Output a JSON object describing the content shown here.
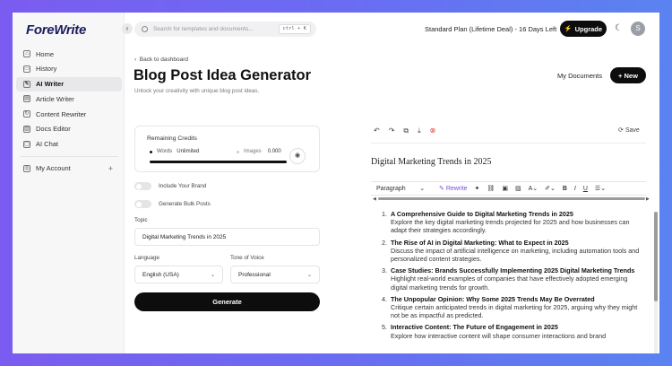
{
  "app": {
    "logo": "ForeWrite"
  },
  "sidebar": {
    "items": [
      {
        "label": "Home",
        "icon": "home-icon",
        "glyph": "⌂"
      },
      {
        "label": "History",
        "icon": "history-icon",
        "glyph": "▭"
      },
      {
        "label": "AI Writer",
        "icon": "ai-writer-icon",
        "glyph": "✎"
      },
      {
        "label": "Article Writer",
        "icon": "article-icon",
        "glyph": "▤"
      },
      {
        "label": "Content Rewriter",
        "icon": "rewriter-icon",
        "glyph": "↻"
      },
      {
        "label": "Docs Editor",
        "icon": "docs-icon",
        "glyph": "▥"
      },
      {
        "label": "AI Chat",
        "icon": "chat-icon",
        "glyph": "▢"
      }
    ],
    "account": {
      "label": "My Account",
      "plus": "+"
    }
  },
  "topbar": {
    "search_placeholder": "Search for templates and documents...",
    "shortcut": "ctrl + K",
    "plan": "Standard Plan (Lifetime Deal) - 16 Days Left",
    "upgrade": "Upgrade",
    "avatar": "S"
  },
  "header": {
    "back": "Back to dashboard",
    "title": "Blog Post Idea Generator",
    "subtitle": "Unlock your creativity with unique blog post ideas.",
    "my_documents": "My Documents",
    "new": "New"
  },
  "credits": {
    "title": "Remaining Credits",
    "words_label": "Words",
    "words_value": "Unlimited",
    "images_label": "Images",
    "images_value": "0.000",
    "bar_fill": 1.0
  },
  "form": {
    "toggle_brand": "Include Your Brand",
    "toggle_bulk": "Generate Bulk Posts",
    "topic_label": "Topic",
    "topic_value": "Digital Marketing Trends in 2025",
    "language_label": "Language",
    "language_value": "English (USA)",
    "tone_label": "Tone of Voice",
    "tone_value": "Professional",
    "generate": "Generate"
  },
  "editor": {
    "save": "Save",
    "title": "Digital Marketing Trends in 2025",
    "paragraph_style": "Paragraph",
    "rewrite": "Rewrite",
    "items": [
      {
        "num": "1.",
        "title": "A Comprehensive Guide to Digital Marketing Trends in 2025",
        "desc": "Explore the key digital marketing trends projected for 2025 and how businesses can adapt their strategies accordingly."
      },
      {
        "num": "2.",
        "title": "The Rise of AI in Digital Marketing: What to Expect in 2025",
        "desc": "Discuss the impact of artificial intelligence on marketing, including automation tools and personalized content strategies."
      },
      {
        "num": "3.",
        "title": "Case Studies: Brands Successfully Implementing 2025 Digital Marketing Trends",
        "desc": "Highlight real-world examples of companies that have effectively adopted emerging digital marketing trends for growth."
      },
      {
        "num": "4.",
        "title": "The Unpopular Opinion: Why Some 2025 Trends May Be Overrated",
        "desc": "Critique certain anticipated trends in digital marketing for 2025, arguing why they might not be as impactful as predicted."
      },
      {
        "num": "5.",
        "title": "Interactive Content: The Future of Engagement in 2025",
        "desc": "Explore how interactive content will shape consumer interactions and brand"
      }
    ]
  }
}
